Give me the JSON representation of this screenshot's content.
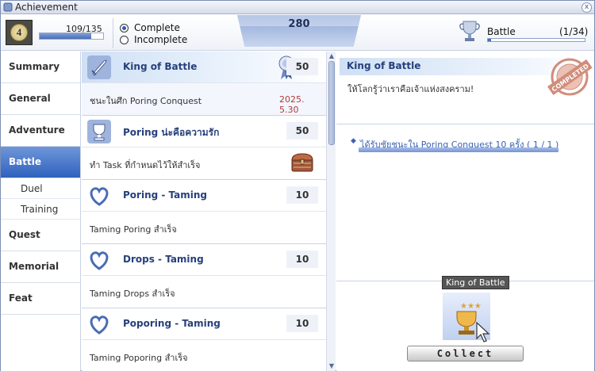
{
  "window": {
    "title": "Achievement",
    "close_label": "x"
  },
  "header": {
    "level": "4",
    "progress_text": "109/135",
    "progress_fraction": 0.807,
    "filters": [
      {
        "label": "Complete",
        "selected": true
      },
      {
        "label": "Incomplete",
        "selected": false
      }
    ],
    "total_points": "280",
    "category": {
      "label": "Battle",
      "count": "(1/34)",
      "fraction": 0.03
    }
  },
  "sidebar": {
    "items": [
      {
        "label": "Summary",
        "active": false,
        "sub": false
      },
      {
        "label": "General",
        "active": false,
        "sub": false
      },
      {
        "label": "Adventure",
        "active": false,
        "sub": false
      },
      {
        "label": "Battle",
        "active": true,
        "sub": false
      },
      {
        "label": "Duel",
        "active": false,
        "sub": true
      },
      {
        "label": "Training",
        "active": false,
        "sub": true
      },
      {
        "label": "Quest",
        "active": false,
        "sub": false
      },
      {
        "label": "Memorial",
        "active": false,
        "sub": false
      },
      {
        "label": "Feat",
        "active": false,
        "sub": false
      }
    ]
  },
  "list": {
    "entries": [
      {
        "name": "King of Battle",
        "score": "50",
        "desc": "ชนะในศึก Poring Conquest",
        "date": "2025. 5.30",
        "icon": "sword-icon",
        "reward": "medal-icon"
      },
      {
        "name": "Poring น่ะคือความรัก",
        "score": "50",
        "desc": "ทำ Task ที่กำหนดไว้ให้สำเร็จ",
        "icon": "trophy-icon",
        "reward": "chest-icon"
      },
      {
        "name": "Poring - Taming",
        "score": "10",
        "desc": "Taming Poring สำเร็จ",
        "icon": "heart-icon"
      },
      {
        "name": "Drops - Taming",
        "score": "10",
        "desc": "Taming Drops สำเร็จ",
        "icon": "heart-icon"
      },
      {
        "name": "Poporing - Taming",
        "score": "10",
        "desc": "Taming Poporing สำเร็จ",
        "icon": "heart-icon"
      }
    ]
  },
  "detail": {
    "title": "King of Battle",
    "desc": "ให้โลกรู้ว่าเราคือเจ้าแห่งสงคราม!",
    "stamp": "COMPLETED",
    "requirement": "ได้รับชัยชนะใน Poring Conquest 10 ครั้ง ( 1 / 1 )",
    "reward_tooltip": "King of Battle",
    "collect_label": "Collect"
  },
  "colors": {
    "accent": "#2f62bf",
    "title_blue": "#26407a",
    "stamp": "#c97a64"
  }
}
